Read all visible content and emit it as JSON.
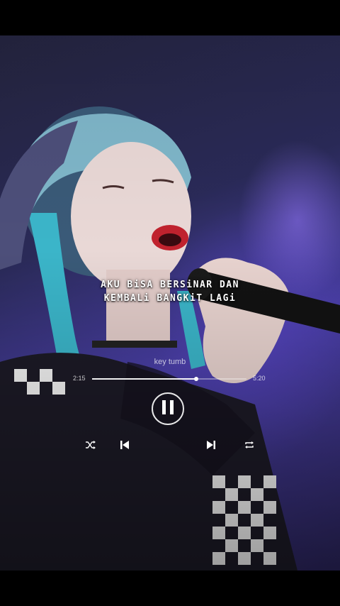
{
  "lyrics": {
    "line1": "AKU BiSA BERSiNAR DAN",
    "line2": "KEMBALi BANGKiT LAGi"
  },
  "player": {
    "song_title": "key tumb",
    "current_time": "2:15",
    "total_time": "5:20",
    "progress": 0.675
  },
  "icons": {
    "shuffle": "shuffle-icon",
    "previous": "skip-previous-icon",
    "pause": "pause-icon",
    "next": "skip-next-icon",
    "repeat": "repeat-icon"
  }
}
